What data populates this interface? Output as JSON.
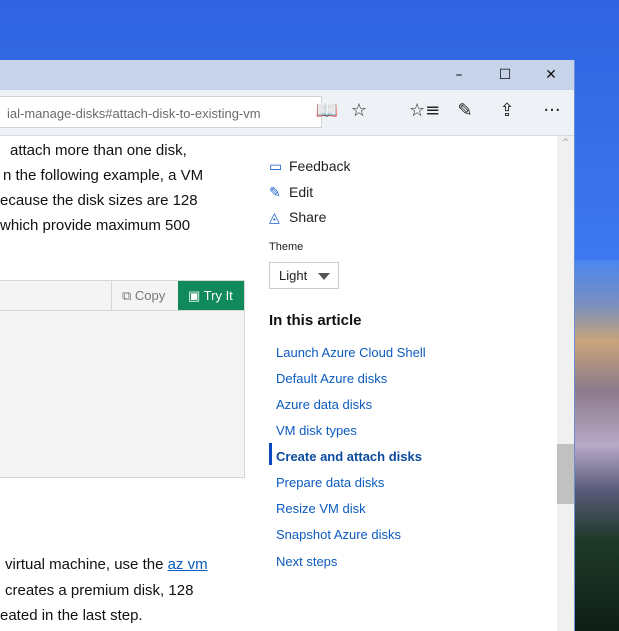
{
  "browser": {
    "address": "ial-manage-disks#attach-disk-to-existing-vm",
    "icons": [
      "reading-view-icon",
      "favorite-star-icon",
      "favorites-list-icon",
      "web-note-icon",
      "share-icon",
      "more-icon"
    ]
  },
  "window_controls": {
    "minimize": "–",
    "maximize": "☐",
    "close": "✕"
  },
  "article": {
    "lines_top": [
      "attach more than one disk,",
      "n the following example, a VM",
      "ecause the disk sizes are 128",
      "which provide maximum 500"
    ],
    "code": {
      "copy_label": "Copy",
      "tryit_label": "Try It"
    },
    "lines_bottom": {
      "line1_text": "virtual machine, use the ",
      "line1_link": "az vm",
      "line2": "creates a premium disk, 128",
      "line3": "eated in the last step."
    }
  },
  "sidebar": {
    "actions": [
      {
        "label": "Feedback",
        "icon": "feedback-icon"
      },
      {
        "label": "Edit",
        "icon": "pencil-icon"
      },
      {
        "label": "Share",
        "icon": "share-icon"
      }
    ],
    "theme_label": "Theme",
    "theme_value": "Light",
    "toc_title": "In this article",
    "toc": [
      "Launch Azure Cloud Shell",
      "Default Azure disks",
      "Azure data disks",
      "VM disk types",
      "Create and attach disks",
      "Prepare data disks",
      "Resize VM disk",
      "Snapshot Azure disks",
      "Next steps"
    ],
    "toc_active": "Create and attach disks"
  },
  "colors": {
    "accent": "#0c5bbf",
    "tryit": "#108a5a"
  }
}
